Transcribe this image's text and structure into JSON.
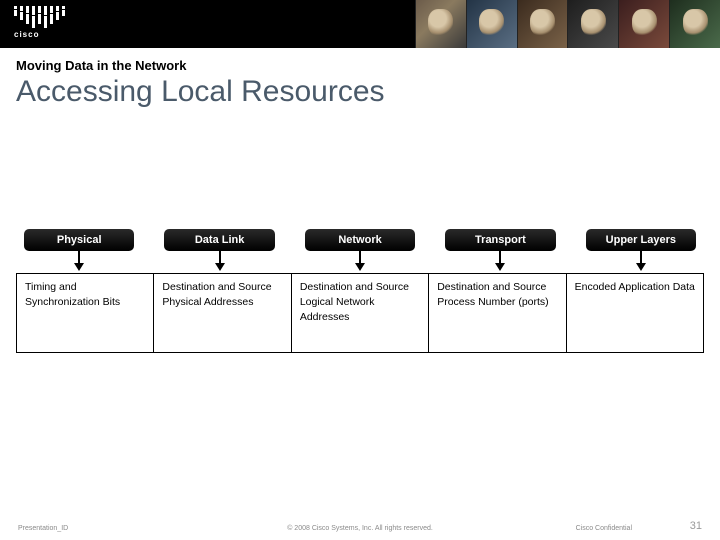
{
  "branding": {
    "logo_text": "cisco"
  },
  "titles": {
    "kicker": "Moving Data in the Network",
    "main": "Accessing Local Resources"
  },
  "layers": [
    {
      "name": "Physical",
      "desc": "Timing and Synchronization Bits"
    },
    {
      "name": "Data Link",
      "desc": "Destination and Source Physical Addresses"
    },
    {
      "name": "Network",
      "desc": "Destination and Source Logical Network Addresses"
    },
    {
      "name": "Transport",
      "desc": "Destination and Source Process Number (ports)"
    },
    {
      "name": "Upper Layers",
      "desc": "Encoded Application Data"
    }
  ],
  "footer": {
    "presentation_id": "Presentation_ID",
    "copyright": "© 2008 Cisco Systems, Inc. All rights reserved.",
    "confidential": "Cisco Confidential",
    "slide_number": "31"
  }
}
